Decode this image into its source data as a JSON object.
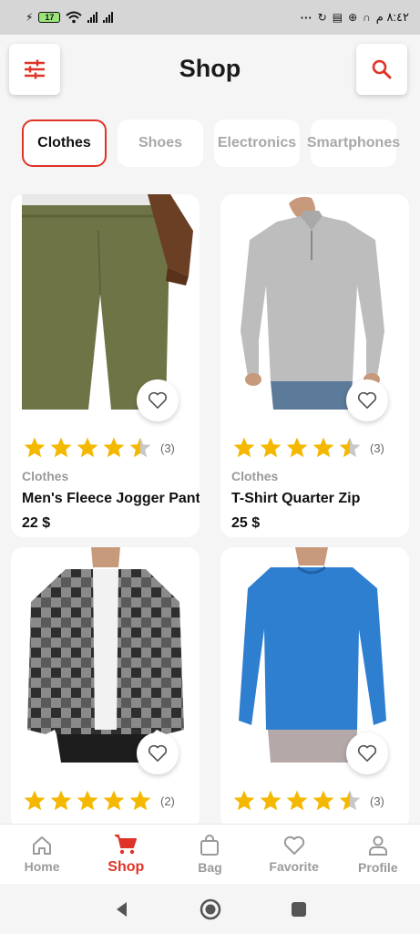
{
  "status_bar": {
    "battery": "17",
    "right_text": "٨:٤٢ م",
    "more": "···"
  },
  "header": {
    "title": "Shop"
  },
  "categories": [
    {
      "label": "Clothes",
      "active": true
    },
    {
      "label": "Shoes",
      "active": false
    },
    {
      "label": "Electronics",
      "active": false
    },
    {
      "label": "Smartphones",
      "active": false
    }
  ],
  "products": [
    {
      "category": "Clothes",
      "name": "Men's Fleece Jogger Pant",
      "price": "22 $",
      "rating": 4.5,
      "rating_count": "(3)"
    },
    {
      "category": "Clothes",
      "name": "T-Shirt Quarter Zip",
      "price": "25 $",
      "rating": 4.5,
      "rating_count": "(3)"
    },
    {
      "category": "",
      "name": "",
      "price": "",
      "rating": 5,
      "rating_count": "(2)"
    },
    {
      "category": "",
      "name": "",
      "price": "",
      "rating": 4.5,
      "rating_count": "(3)"
    }
  ],
  "bottom_nav": [
    {
      "label": "Home",
      "icon": "home-icon",
      "active": false
    },
    {
      "label": "Shop",
      "icon": "cart-icon",
      "active": true
    },
    {
      "label": "Bag",
      "icon": "bag-icon",
      "active": false
    },
    {
      "label": "Favorite",
      "icon": "heart-icon",
      "active": false
    },
    {
      "label": "Profile",
      "icon": "profile-icon",
      "active": false
    }
  ],
  "colors": {
    "accent": "#e03327",
    "star": "#f5b800",
    "inactive": "#9a9a9a"
  }
}
